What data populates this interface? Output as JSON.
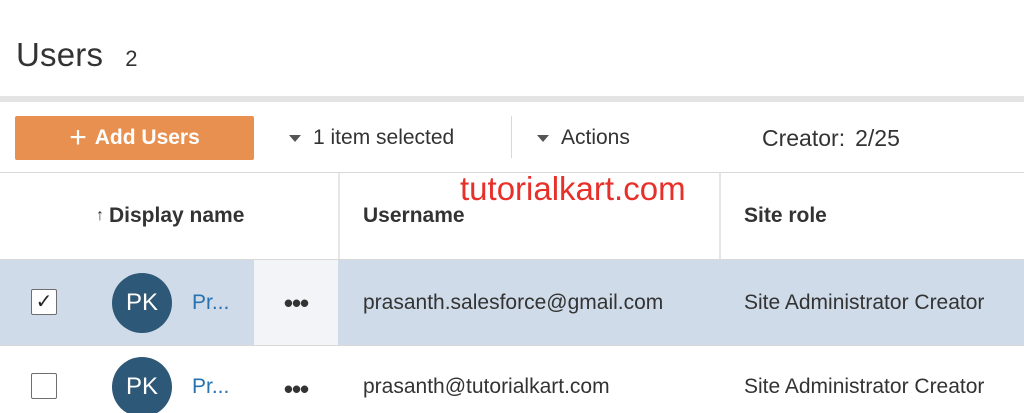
{
  "header": {
    "title": "Users",
    "count": "2"
  },
  "toolbar": {
    "add_plus": "+",
    "add_label": "Add Users",
    "selection_label": "1 item selected",
    "actions_label": "Actions",
    "creator_label": "Creator:",
    "creator_value": "2/25"
  },
  "watermark": "tutorialkart.com",
  "table": {
    "columns": {
      "display_name": "Display name",
      "username": "Username",
      "site_role": "Site role"
    },
    "sort_indicator": "↑",
    "rows": [
      {
        "selected": true,
        "check": "✓",
        "initials": "PK",
        "name": "Pr...",
        "more": "•••",
        "username": "prasanth.salesforce@gmail.com",
        "site_role": "Site Administrator Creator"
      },
      {
        "selected": false,
        "check": "",
        "initials": "PK",
        "name": "Pr...",
        "more": "•••",
        "username": "prasanth@tutorialkart.com",
        "site_role": "Site Administrator Creator"
      }
    ]
  },
  "colors": {
    "accent_orange": "#e8904f",
    "selected_row": "#cfdbe8",
    "avatar": "#2e5877",
    "link": "#2872b0",
    "watermark": "#e8302a"
  },
  "icons": [
    "plus-icon",
    "caret-down-icon",
    "sort-up-icon",
    "check-icon",
    "more-horizontal-icon"
  ]
}
